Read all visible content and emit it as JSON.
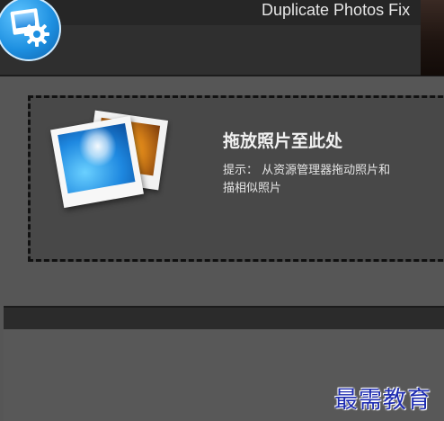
{
  "window": {
    "title": "Duplicate Photos Fix"
  },
  "drop_zone": {
    "title": "拖放照片至此处",
    "hint_line1": "提示： 从资源管理器拖动照片和",
    "hint_line2": "描相似照片"
  },
  "watermark": {
    "text": "最需教育"
  },
  "icons": {
    "app_logo": "app-logo-icon",
    "photos": "photo-stack-icon"
  },
  "colors": {
    "titlebar": "#262626",
    "toolbar": "#2f2f2f",
    "drop_zone_bg": "#484848",
    "watermark": "#1d2bb0"
  }
}
